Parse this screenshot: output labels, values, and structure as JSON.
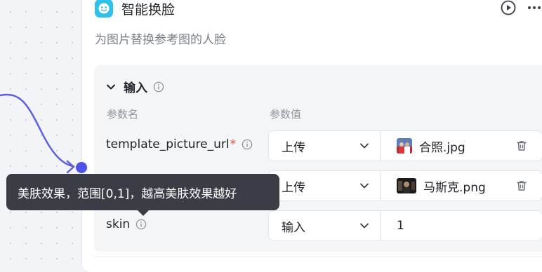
{
  "node": {
    "title": "智能换脸",
    "description": "为图片替换参考图的人脸"
  },
  "input_section": {
    "title": "输入",
    "col_param_name": "参数名",
    "col_param_value": "参数值",
    "params": [
      {
        "name": "template_picture_url",
        "required": "*",
        "source": "上传",
        "file_name": "合照.jpg",
        "thumb_icon": "photo-thumb-icon"
      },
      {
        "name": "",
        "source": "上传",
        "file_name": "马斯克.png",
        "thumb_icon": "photo-thumb-icon"
      },
      {
        "name": "skin",
        "source": "输入",
        "value": "1"
      }
    ]
  },
  "tooltip": {
    "text": "美肤效果，范围[0,1]，越高美肤效果越好"
  },
  "colors": {
    "accent": "#4d53e8",
    "app_icon": "#2fc1e8",
    "required": "#f54a45",
    "tooltip_bg": "#3a3d45"
  }
}
